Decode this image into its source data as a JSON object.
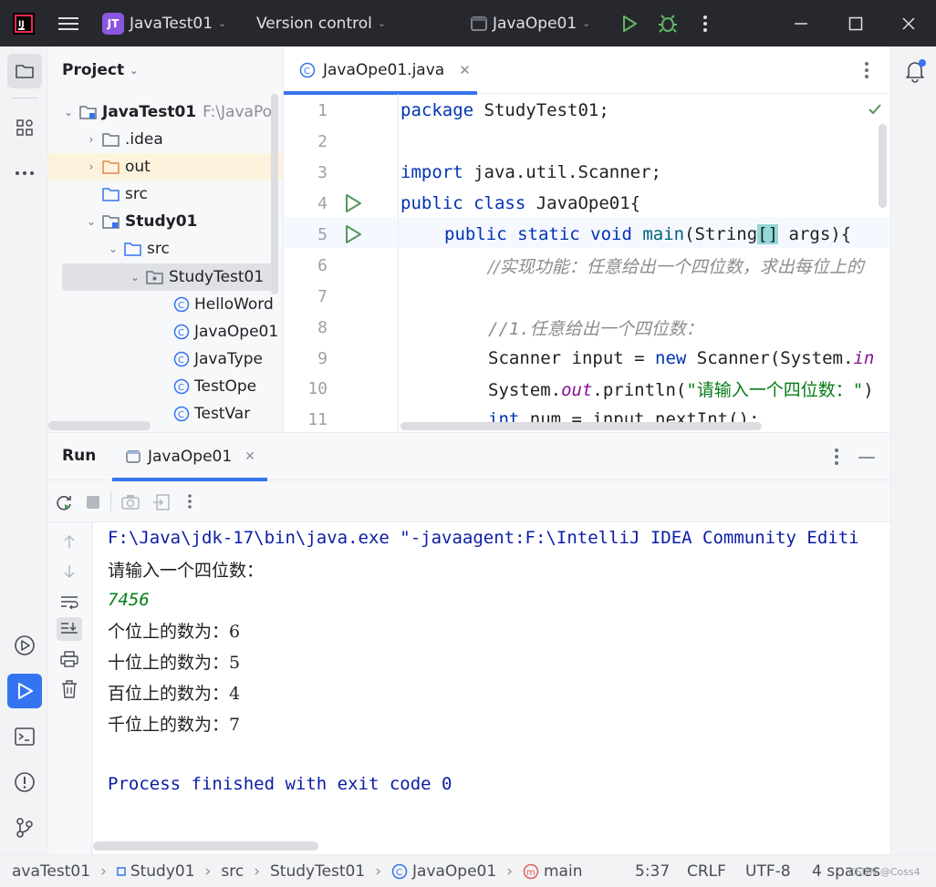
{
  "titlebar": {
    "project_badge": "JT",
    "project_name": "JavaTest01",
    "vcs": "Version control",
    "run_config": "JavaOpe01"
  },
  "project_panel": {
    "title": "Project",
    "tree": [
      {
        "label": "JavaTest01",
        "extra": "F:\\JavaPo",
        "icon": "module-folder-icon"
      },
      {
        "label": ".idea",
        "icon": "folder-icon"
      },
      {
        "label": "out",
        "icon": "folder-orange-icon"
      },
      {
        "label": "src",
        "icon": "source-folder-icon"
      },
      {
        "label": "Study01",
        "icon": "module-folder-icon"
      },
      {
        "label": "src",
        "icon": "source-folder-icon"
      },
      {
        "label": "StudyTest01",
        "icon": "package-icon"
      },
      {
        "label": "HelloWord",
        "icon": "class-icon"
      },
      {
        "label": "JavaOpe01",
        "icon": "class-icon"
      },
      {
        "label": "JavaType",
        "icon": "class-icon"
      },
      {
        "label": "TestOpe",
        "icon": "class-icon"
      },
      {
        "label": "TestVar",
        "icon": "class-icon"
      }
    ]
  },
  "editor": {
    "tab_label": "JavaOpe01.java",
    "line_numbers": [
      "1",
      "2",
      "3",
      "4",
      "5",
      "6",
      "7",
      "8",
      "9",
      "10",
      "11"
    ],
    "code": {
      "l1_kw": "package",
      "l1_rest": " StudyTest01;",
      "l3_kw": "import",
      "l3_rest": " java.util.Scanner;",
      "l4_kw": "public class",
      "l4_rest": " JavaOpe01{",
      "l5_kw": "public static void",
      "l5_fn": " main",
      "l5_a": "(String",
      "l5_br": "[]",
      "l5_b": " args){",
      "l6": "//实现功能：任意给出一个四位数，求出每位上的",
      "l8": "//1.任意给出一个四位数：",
      "l9_a": "Scanner input = ",
      "l9_kw": "new",
      "l9_b": " Scanner(System.",
      "l9_fld": "in",
      "l10_a": "System.",
      "l10_fld": "out",
      "l10_b": ".println(",
      "l10_str": "\"请输入一个四位数：\"",
      "l10_c": ")",
      "l11_kw": "int",
      "l11_rest": " num = input.nextInt();"
    }
  },
  "run_panel": {
    "title": "Run",
    "tab_label": "JavaOpe01",
    "console": {
      "cmd": "F:\\Java\\jdk-17\\bin\\java.exe \"-javaagent:F:\\IntelliJ IDEA Community Editi",
      "prompt": "请输入一个四位数：",
      "input": "7456",
      "out1": "个位上的数为：6",
      "out2": "十位上的数为：5",
      "out3": "百位上的数为：4",
      "out4": "千位上的数为：7",
      "finish": "Process finished with exit code 0"
    }
  },
  "statusbar": {
    "crumb1": "avaTest01",
    "crumb2": "Study01",
    "crumb3": "src",
    "crumb4": "StudyTest01",
    "crumb5": "JavaOpe01",
    "crumb6": "main",
    "position": "5:37",
    "line_sep": "CRLF",
    "encoding": "UTF-8",
    "indent": "4 spaces",
    "watermark": "CSDN @Coss4"
  },
  "colors": {
    "accent": "#3574f0",
    "run_green": "#57965c",
    "keyword": "#0033b3",
    "string": "#067d17",
    "comment": "#8c8c8c"
  }
}
